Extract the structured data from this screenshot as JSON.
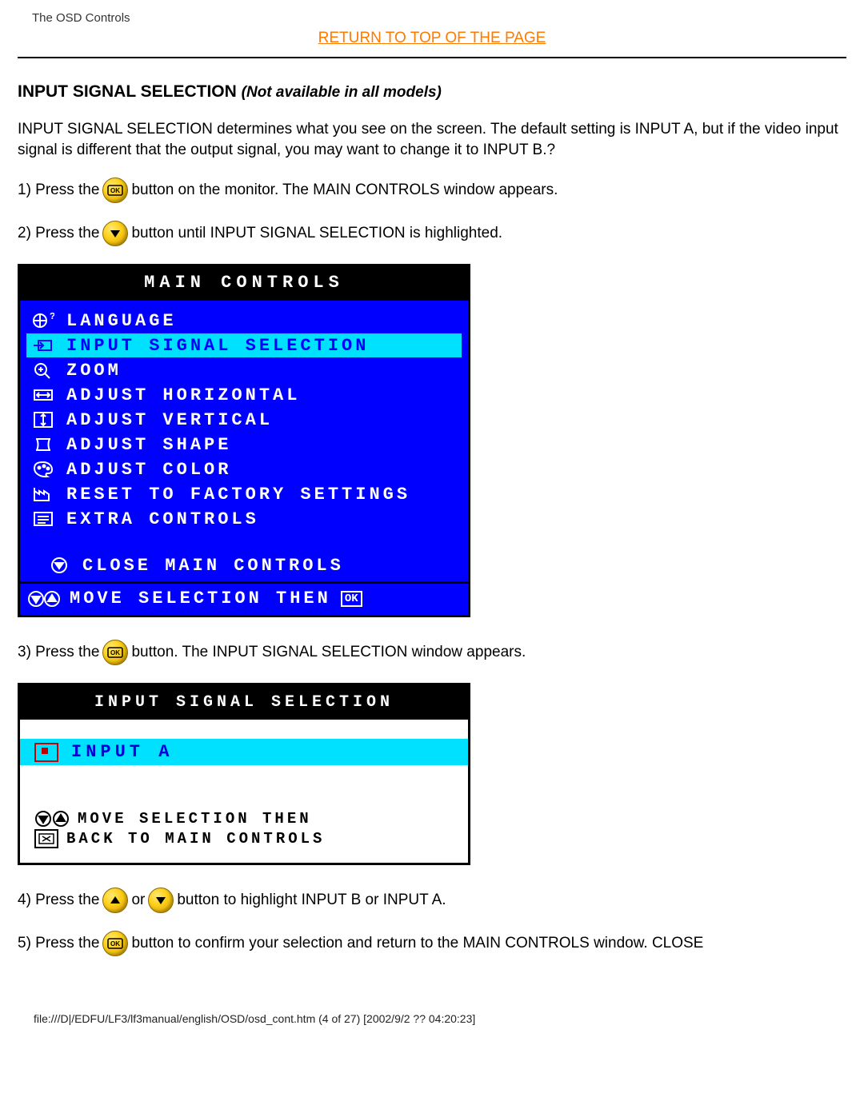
{
  "header": {
    "small_title": "The OSD Controls"
  },
  "return_link": "RETURN TO TOP OF THE PAGE",
  "section": {
    "title": "INPUT SIGNAL SELECTION",
    "note": "(Not available in all models)"
  },
  "intro": "INPUT SIGNAL SELECTION determines what you see on the screen. The default setting is INPUT A, but if the video input signal is different that the output signal, you may want to change it to INPUT B.?",
  "steps": {
    "s1a": "1) Press the",
    "s1b": "button on the monitor. The MAIN CONTROLS window appears.",
    "s2a": "2) Press the",
    "s2b": "button until INPUT SIGNAL SELECTION is highlighted.",
    "s3a": "3) Press the",
    "s3b": "button. The INPUT SIGNAL SELECTION window appears.",
    "s4a": "4) Press the",
    "s4b": "or",
    "s4c": " button to highlight INPUT B or INPUT A.",
    "s5a": "5) Press the",
    "s5b": "button to confirm your selection and return to the MAIN CONTROLS window. CLOSE"
  },
  "osd": {
    "title": "MAIN CONTROLS",
    "items": [
      {
        "label": "LANGUAGE",
        "icon": "globe-question-icon"
      },
      {
        "label": "INPUT SIGNAL SELECTION",
        "icon": "input-arrow-icon",
        "selected": true
      },
      {
        "label": "ZOOM",
        "icon": "magnifier-icon"
      },
      {
        "label": "ADJUST HORIZONTAL",
        "icon": "horizontal-icon"
      },
      {
        "label": "ADJUST VERTICAL",
        "icon": "vertical-icon"
      },
      {
        "label": "ADJUST SHAPE",
        "icon": "shape-icon"
      },
      {
        "label": "ADJUST COLOR",
        "icon": "palette-icon"
      },
      {
        "label": "RESET TO FACTORY SETTINGS",
        "icon": "factory-icon"
      },
      {
        "label": "EXTRA CONTROLS",
        "icon": "list-icon"
      }
    ],
    "close": "CLOSE MAIN CONTROLS",
    "footer": "MOVE SELECTION THEN"
  },
  "iss": {
    "title": "INPUT SIGNAL SELECTION",
    "selected": "INPUT A",
    "footer_line1": "MOVE SELECTION THEN",
    "footer_line2": "BACK TO MAIN CONTROLS"
  },
  "footer_path": "file:///D|/EDFU/LF3/lf3manual/english/OSD/osd_cont.htm (4 of 27) [2002/9/2 ?? 04:20:23]"
}
